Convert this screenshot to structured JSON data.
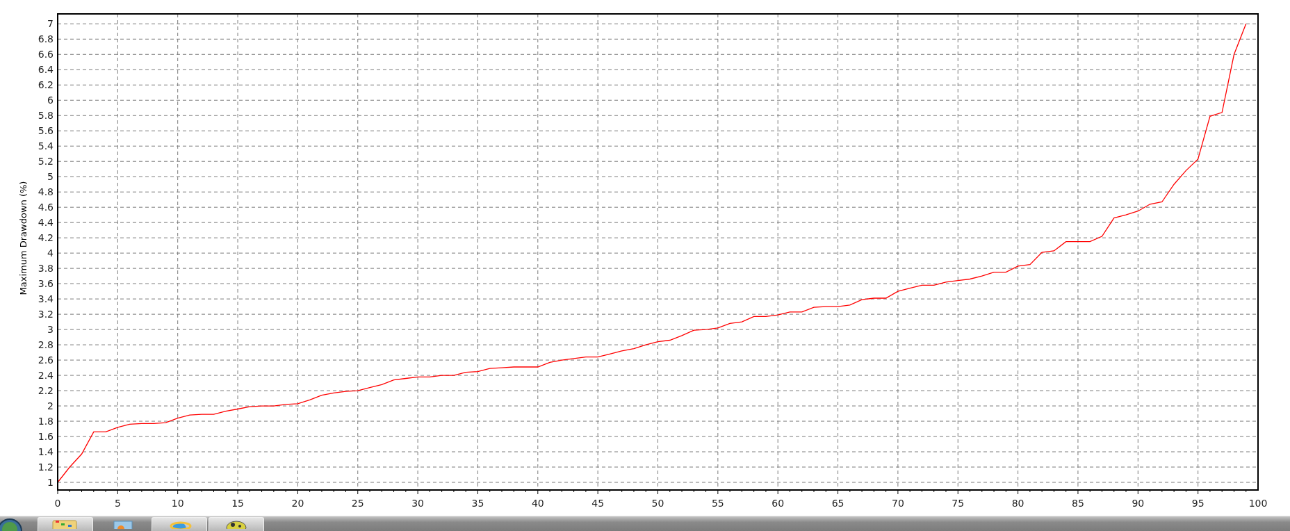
{
  "chart": {
    "chart_data": {
      "type": "line",
      "grid": true,
      "ylabel": "Maximum Drawdown (%)",
      "xlim": [
        0,
        100
      ],
      "ylim": [
        0.9,
        7.13
      ],
      "xticks": [
        0,
        5,
        10,
        15,
        20,
        25,
        30,
        35,
        40,
        45,
        50,
        55,
        60,
        65,
        70,
        75,
        80,
        85,
        90,
        95,
        100
      ],
      "yticks": [
        1,
        1.2,
        1.4,
        1.6,
        1.8,
        2,
        2.2,
        2.4,
        2.6,
        2.8,
        3,
        3.2,
        3.4,
        3.6,
        3.8,
        4,
        4.2,
        4.4,
        4.6,
        4.8,
        5,
        5.2,
        5.4,
        5.6,
        5.8,
        6,
        6.2,
        6.4,
        6.6,
        6.8,
        7
      ],
      "x": [
        0,
        1,
        2,
        3,
        4,
        5,
        6,
        7,
        8,
        9,
        10,
        11,
        12,
        13,
        14,
        15,
        16,
        17,
        18,
        19,
        20,
        21,
        22,
        23,
        24,
        25,
        26,
        27,
        28,
        29,
        30,
        31,
        32,
        33,
        34,
        35,
        36,
        37,
        38,
        39,
        40,
        41,
        42,
        43,
        44,
        45,
        46,
        47,
        48,
        49,
        50,
        51,
        52,
        53,
        54,
        55,
        56,
        57,
        58,
        59,
        60,
        61,
        62,
        63,
        64,
        65,
        66,
        67,
        68,
        69,
        70,
        71,
        72,
        73,
        74,
        75,
        76,
        77,
        78,
        79,
        80,
        81,
        82,
        83,
        84,
        85,
        86,
        87,
        88,
        89,
        90,
        91,
        92,
        93,
        94,
        95,
        96,
        97,
        98,
        99
      ],
      "series": [
        {
          "color": "#ff0000",
          "values": [
            1.0,
            1.2,
            1.37,
            1.66,
            1.66,
            1.72,
            1.76,
            1.77,
            1.77,
            1.78,
            1.84,
            1.88,
            1.89,
            1.89,
            1.93,
            1.96,
            1.99,
            2.0,
            2.0,
            2.02,
            2.03,
            2.08,
            2.14,
            2.17,
            2.19,
            2.2,
            2.24,
            2.28,
            2.34,
            2.36,
            2.38,
            2.38,
            2.4,
            2.4,
            2.44,
            2.45,
            2.49,
            2.5,
            2.51,
            2.51,
            2.51,
            2.57,
            2.6,
            2.62,
            2.64,
            2.64,
            2.68,
            2.72,
            2.75,
            2.8,
            2.84,
            2.86,
            2.92,
            2.99,
            3.0,
            3.02,
            3.08,
            3.1,
            3.17,
            3.17,
            3.19,
            3.23,
            3.23,
            3.29,
            3.3,
            3.3,
            3.32,
            3.39,
            3.41,
            3.41,
            3.5,
            3.54,
            3.58,
            3.58,
            3.62,
            3.64,
            3.66,
            3.7,
            3.75,
            3.75,
            3.83,
            3.85,
            4.01,
            4.03,
            4.15,
            4.15,
            4.15,
            4.22,
            4.46,
            4.5,
            4.55,
            4.64,
            4.67,
            4.9,
            5.08,
            5.23,
            5.79,
            5.84,
            6.6,
            7.0
          ]
        }
      ]
    }
  }
}
